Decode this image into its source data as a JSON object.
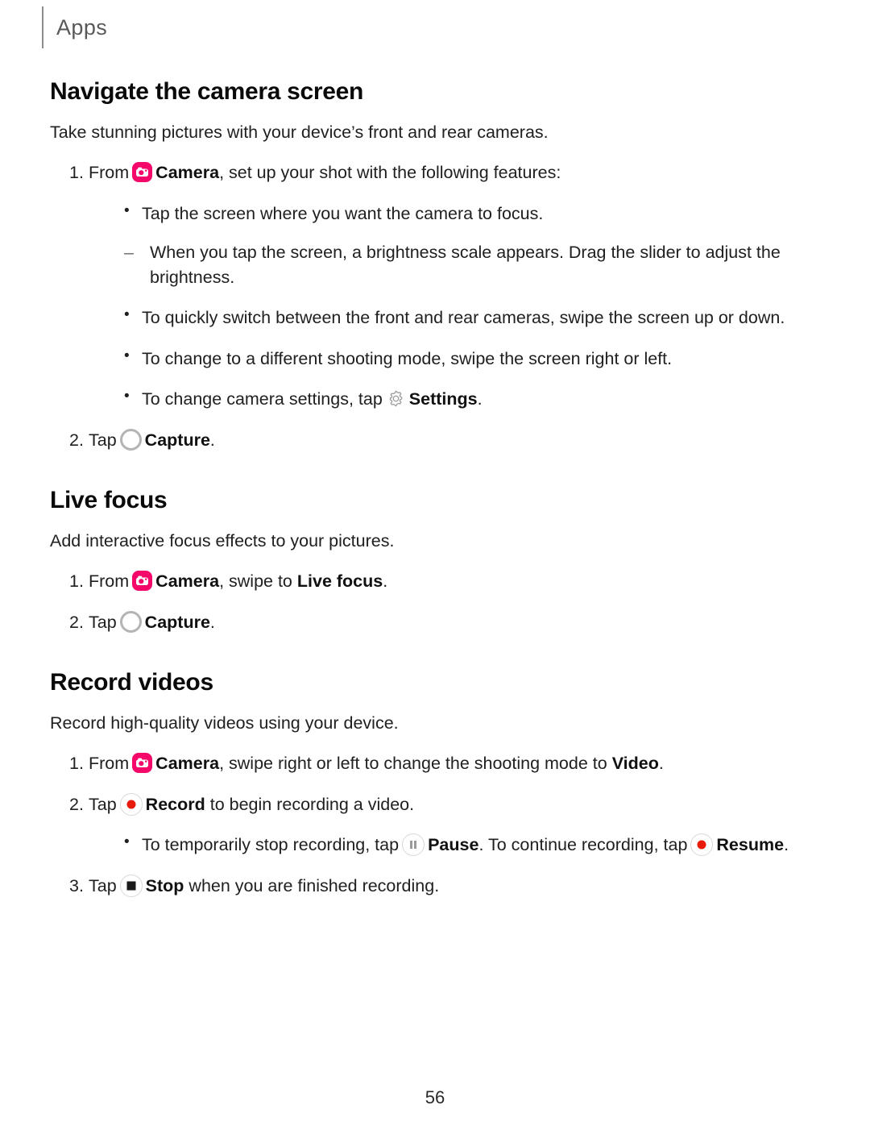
{
  "header": {
    "label": "Apps"
  },
  "colors": {
    "camera_icon_bg": "#F4096B",
    "record_dot": "#E81A0C",
    "rule_gray": "#8C8C8C",
    "icon_outline_gray": "#D8D8D8",
    "text": "#202020"
  },
  "sections": [
    {
      "title": "Navigate the camera screen",
      "intro": "Take stunning pictures with your device’s front and rear cameras.",
      "steps": [
        {
          "num": "1.",
          "pre": "From",
          "icon": "camera-icon",
          "bold": "Camera",
          "post": ", set up your shot with the following features:"
        },
        {
          "num": "2.",
          "pre": "Tap",
          "icon": "capture-icon",
          "bold": "Capture",
          "post": "."
        }
      ],
      "bullets": [
        "Tap the screen where you want the camera to focus.",
        "To quickly switch between the front and rear cameras, swipe the screen up or down.",
        "To change to a different shooting mode, swipe the screen right or left."
      ],
      "bullet_settings": {
        "pre": "To change camera settings, tap",
        "icon": "gear-icon",
        "bold": "Settings",
        "post": "."
      },
      "dashes": [
        "When you tap the screen, a brightness scale appears. Drag the slider to adjust the brightness."
      ]
    },
    {
      "title": "Live focus",
      "intro": "Add interactive focus effects to your pictures.",
      "steps": [
        {
          "num": "1.",
          "pre": "From",
          "icon": "camera-icon",
          "bold": "Camera",
          "mid": ", swipe to",
          "bold2": "Live focus",
          "post": "."
        },
        {
          "num": "2.",
          "pre": "Tap",
          "icon": "capture-icon",
          "bold": "Capture",
          "post": "."
        }
      ]
    },
    {
      "title": "Record videos",
      "intro": "Record high-quality videos using your device.",
      "steps": [
        {
          "num": "1.",
          "pre": "From",
          "icon": "camera-icon",
          "bold": "Camera",
          "mid": ", swipe right or left to change the shooting mode to",
          "bold2": "Video",
          "post": "."
        },
        {
          "num": "2.",
          "pre": "Tap",
          "icon": "record-icon",
          "bold": "Record",
          "post": " to begin recording a video."
        },
        {
          "num": "3.",
          "pre": "Tap",
          "icon": "stop-icon",
          "bold": "Stop",
          "post": " when you are finished recording."
        }
      ],
      "bullet_pause": {
        "pre": "To temporarily stop recording, tap",
        "icon1": "pause-icon",
        "bold1": "Pause",
        "mid": ". To continue recording, tap",
        "icon2": "record-icon",
        "bold2": "Resume",
        "post": "."
      }
    }
  ],
  "footer": {
    "page_number": "56"
  }
}
